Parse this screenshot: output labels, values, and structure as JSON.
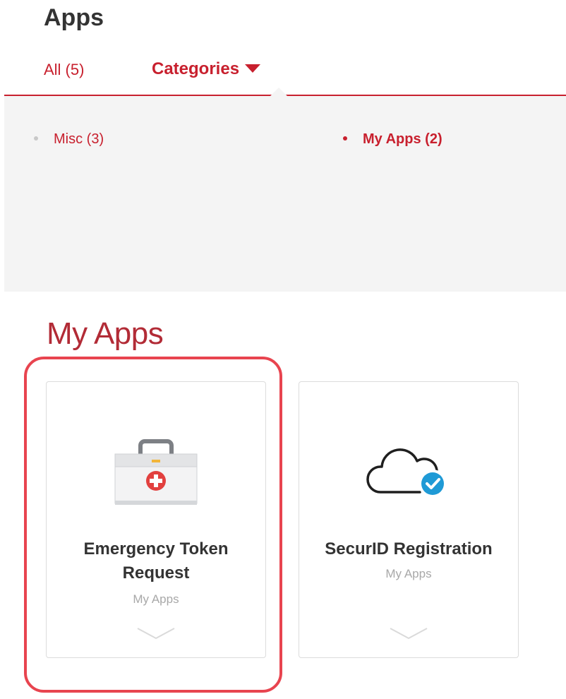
{
  "header": {
    "title": "Apps"
  },
  "tabs": {
    "all_label": "All (5)",
    "categories_label": "Categories"
  },
  "categories": {
    "items": [
      {
        "label": "Misc (3)",
        "selected": false
      },
      {
        "label": "My Apps (2)",
        "selected": true
      }
    ]
  },
  "section": {
    "title": "My Apps"
  },
  "apps": [
    {
      "name": "Emergency Token Request",
      "category": "My Apps",
      "icon": "first-aid-kit-icon",
      "highlighted": true
    },
    {
      "name": "SecurID Registration",
      "category": "My Apps",
      "icon": "cloud-check-icon",
      "highlighted": false
    }
  ],
  "colors": {
    "accent": "#c8202e",
    "section_title": "#b22b36",
    "highlight_ring": "#e8444f",
    "panel_bg": "#f4f4f4"
  }
}
